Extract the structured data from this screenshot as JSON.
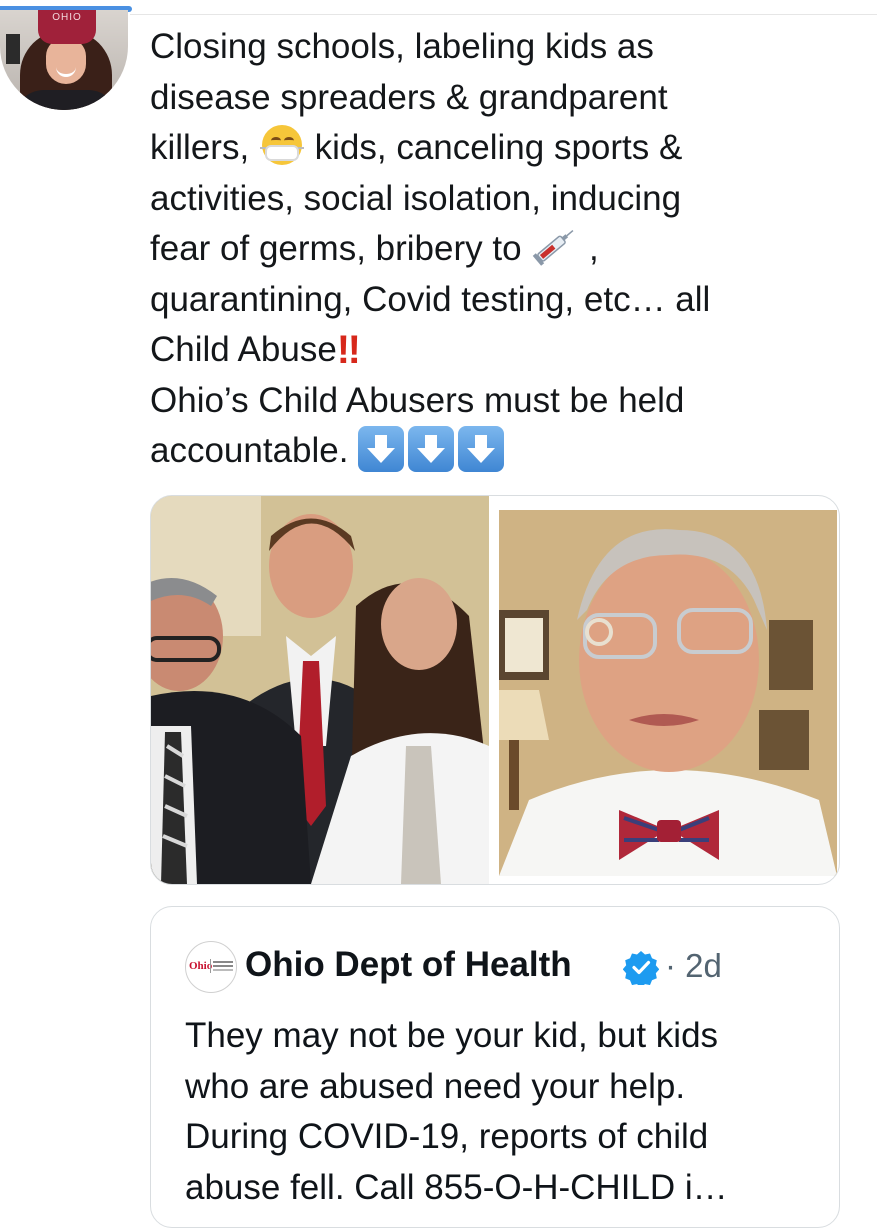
{
  "progress": {
    "fraction": 0.15,
    "color": "#4a90e2"
  },
  "author": {
    "avatar": "profile-photo-woman-in-ohio-beanie",
    "hat_text": "OHIO"
  },
  "tweet": {
    "line1": "Closing schools, labeling kids as",
    "line2": "disease spreaders & grandparent",
    "line3a": "killers,",
    "emoji_mask": "face-with-medical-mask-emoji",
    "line3b": "kids, canceling sports &",
    "line4": "activities, social isolation, inducing",
    "line5a": "fear of germs, bribery to",
    "emoji_syringe": "syringe-emoji",
    "line5b": ",",
    "line6": "quarantining, Covid testing, etc… all",
    "line7": "Child Abuse",
    "emoji_bang": "‼",
    "line8": "Ohio’s Child Abusers must be held",
    "line9": "accountable.",
    "emoji_arrows": [
      "down-arrow-emoji",
      "down-arrow-emoji",
      "down-arrow-emoji"
    ]
  },
  "media": {
    "left_photo": "photo-three-officials-standing",
    "right_photo": "photo-man-in-bow-tie-and-white-coat"
  },
  "quote": {
    "avatar_logo": "Ohio",
    "name": "Ohio Dept of Health",
    "verified": "verified-badge",
    "separator": "·",
    "time": "2d",
    "text_line1": "They may not be your kid, but kids",
    "text_line2": "who are abused need your help.",
    "text_line3": "During COVID-19, reports of child",
    "text_line4": "abuse fell. Call 855-O-H-CHILD i…"
  },
  "colors": {
    "text": "#14171a",
    "secondary": "#536471",
    "verified": "#1d9bf0",
    "border": "#d9dde0"
  }
}
